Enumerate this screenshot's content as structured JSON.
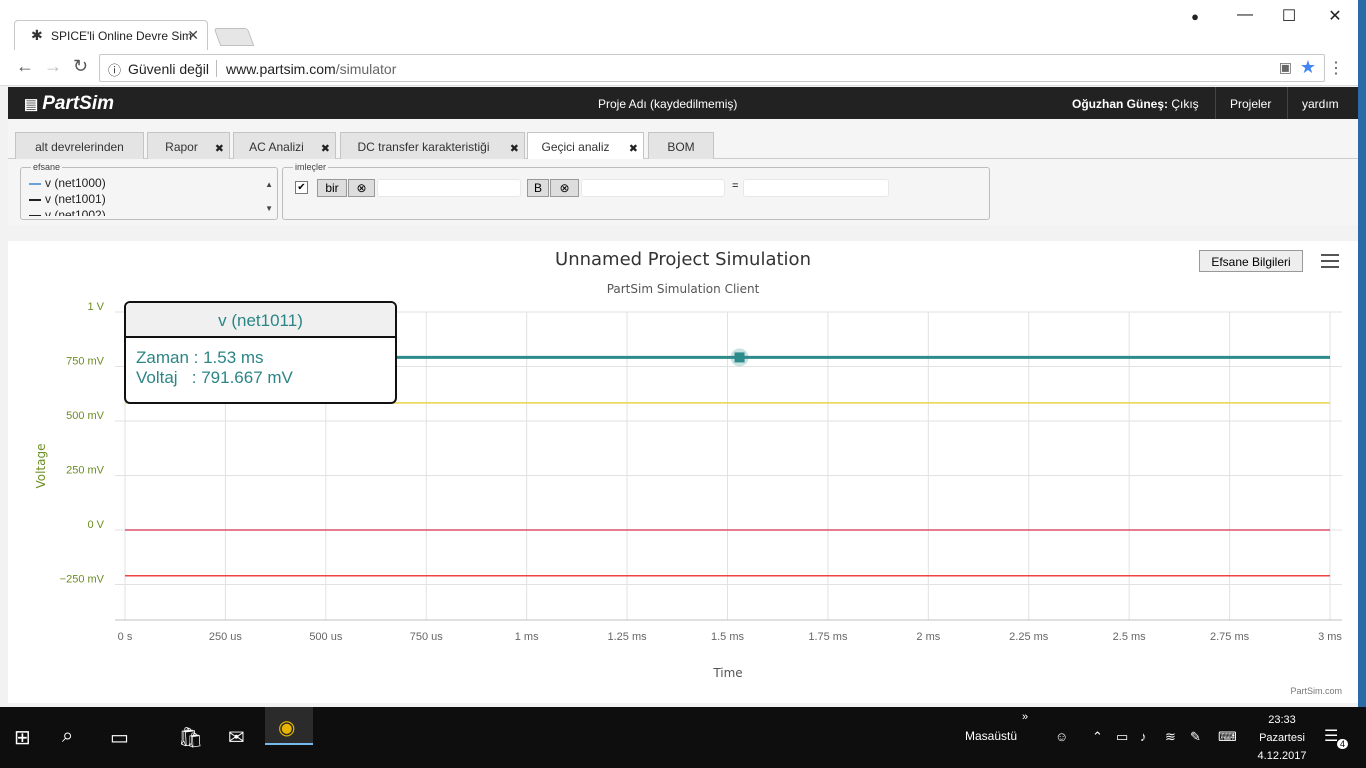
{
  "browser": {
    "tab_title": "SPICE'li Online Devre Sim",
    "security": "Güvenli değil",
    "url_host": "www.partsim.com",
    "url_path": "/simulator"
  },
  "app": {
    "logo": "PartSim",
    "project_name": "Proje Adı (kaydedilmemiş)",
    "user": "Oğuzhan Güneş:",
    "logout": "Çıkış",
    "nav": [
      "Projeler",
      "yardım"
    ]
  },
  "sim_tabs": [
    {
      "label": "alt devrelerinden",
      "closable": false
    },
    {
      "label": "Rapor",
      "closable": true
    },
    {
      "label": "AC Analizi",
      "closable": true
    },
    {
      "label": "DC transfer karakteristiği",
      "closable": true
    },
    {
      "label": "Geçici analiz",
      "closable": true,
      "active": true
    },
    {
      "label": "BOM",
      "closable": false
    }
  ],
  "legend_box": {
    "title": "efsane",
    "items": [
      {
        "label": "v (net1000)",
        "color": "#6aa0d8"
      },
      {
        "label": "v (net1001)",
        "color": "#222222"
      },
      {
        "label": "v (net1002)",
        "color": "#222222"
      }
    ]
  },
  "cursors": {
    "title": "imleçler",
    "a_label": "bir",
    "b_label": "B",
    "clear_symbol": "⊗",
    "eq": "="
  },
  "chart_data": {
    "type": "line",
    "title": "Unnamed Project Simulation",
    "subtitle": "PartSim Simulation Client",
    "xlabel": "Time",
    "ylabel": "Voltage",
    "credit": "PartSim.com",
    "xlim": [
      0,
      3.0
    ],
    "ylim": [
      -0.3,
      1.0
    ],
    "x_ticks": [
      {
        "v": 0,
        "label": "0 s"
      },
      {
        "v": 0.25,
        "label": "250 us"
      },
      {
        "v": 0.5,
        "label": "500 us"
      },
      {
        "v": 0.75,
        "label": "750 us"
      },
      {
        "v": 1.0,
        "label": "1 ms"
      },
      {
        "v": 1.25,
        "label": "1.25 ms"
      },
      {
        "v": 1.5,
        "label": "1.5 ms"
      },
      {
        "v": 1.75,
        "label": "1.75 ms"
      },
      {
        "v": 2.0,
        "label": "2 ms"
      },
      {
        "v": 2.25,
        "label": "2.25 ms"
      },
      {
        "v": 2.5,
        "label": "2.5 ms"
      },
      {
        "v": 2.75,
        "label": "2.75 ms"
      },
      {
        "v": 3.0,
        "label": "3 ms"
      }
    ],
    "y_ticks": [
      {
        "v": 1.0,
        "label": "1 V"
      },
      {
        "v": 0.75,
        "label": "750 mV"
      },
      {
        "v": 0.5,
        "label": "500 mV"
      },
      {
        "v": 0.25,
        "label": "250 mV"
      },
      {
        "v": 0,
        "label": "0 V"
      },
      {
        "v": -0.25,
        "label": "−250 mV"
      }
    ],
    "series": [
      {
        "name": "v (net1011)",
        "color": "#2e8b8b",
        "x": [
          0,
          3.0
        ],
        "values": [
          0.7917,
          0.7917
        ],
        "width": 3
      },
      {
        "color": "#e6d44a",
        "x": [
          0,
          3.0
        ],
        "values": [
          0.583,
          0.583
        ],
        "width": 1.5
      },
      {
        "color": "#d9546a",
        "x": [
          0,
          3.0
        ],
        "values": [
          0.0,
          0.0
        ],
        "width": 1.5
      },
      {
        "color": "#ee4444",
        "x": [
          0,
          3.0
        ],
        "values": [
          -0.21,
          -0.21
        ],
        "width": 1.5
      }
    ],
    "marker": {
      "x": 1.53,
      "y": 0.7917,
      "color": "#2e8b8b"
    }
  },
  "chart_ui": {
    "legend_button": "Efsane Bilgileri"
  },
  "tooltip": {
    "series": "v (net1011)",
    "time": "Zaman : 1.53 ms",
    "voltage": "Voltaj   : 791.667 mV"
  },
  "taskbar": {
    "desktop_label": "Masaüstü",
    "time": "23:33",
    "day": "Pazartesi",
    "date": "4.12.2017",
    "notifications": "4"
  }
}
